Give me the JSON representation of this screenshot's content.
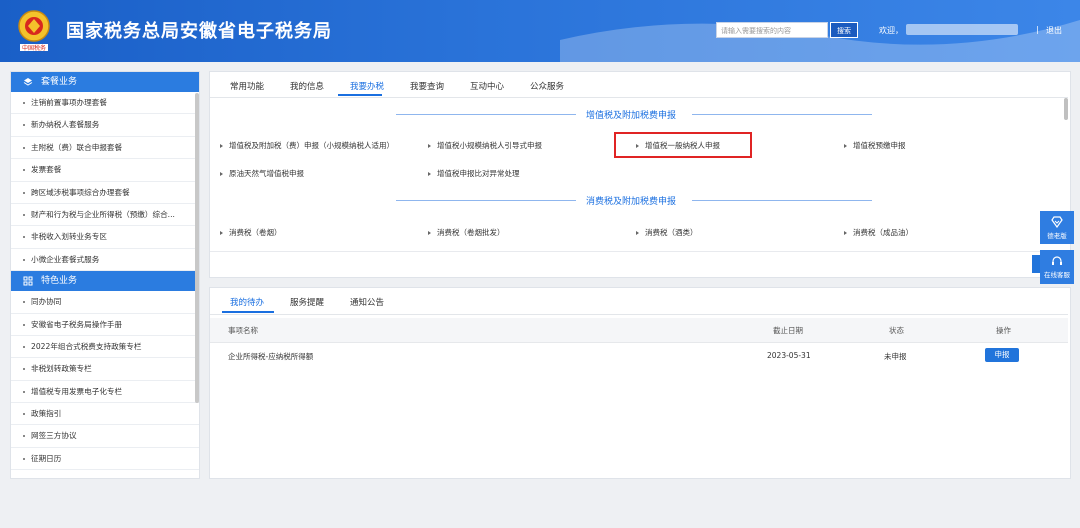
{
  "header": {
    "title": "国家税务总局安徽省电子税务局",
    "search_placeholder": "请输入需要搜索的内容",
    "search_button": "搜索",
    "welcome": "欢迎，",
    "separator": "|",
    "logout": "退出"
  },
  "sidebar": {
    "section1": "套餐业务",
    "items1": [
      "注销前置事项办理套餐",
      "新办纳税人套餐服务",
      "主附税（费）联合申报套餐",
      "发票套餐",
      "跨区域涉税事项综合办理套餐",
      "财产和行为税与企业所得税（预缴）综合...",
      "非税收入划转业务专区",
      "小微企业套餐式服务"
    ],
    "section2": "特色业务",
    "items2": [
      "同办协同",
      "安徽省电子税务局操作手册",
      "2022年组合式税费支持政策专栏",
      "非税划转政策专栏",
      "增值税专用发票电子化专栏",
      "政策指引",
      "网签三方协议",
      "征期日历"
    ]
  },
  "main_tabs": [
    "常用功能",
    "我的信息",
    "我要办税",
    "我要查询",
    "互动中心",
    "公众服务"
  ],
  "section_vat": {
    "title": "增值税及附加税费申报",
    "links": [
      "增值税及附加税（费）申报（小规模纳税人适用）",
      "增值税小规模纳税人引导式申报",
      "增值税一般纳税人申报",
      "增值税预缴申报",
      "原油天然气增值税申报",
      "增值税申报比对异常处理"
    ]
  },
  "section_consumption": {
    "title": "消费税及附加税费申报",
    "links": [
      "消费税（卷烟）",
      "消费税（卷烟批发）",
      "消费税（酒类）",
      "消费税（成品油）"
    ]
  },
  "bottom_tabs": [
    "我的待办",
    "服务提醒",
    "通知公告"
  ],
  "table": {
    "headers": [
      "事项名称",
      "截止日期",
      "状态",
      "操作"
    ],
    "rows": [
      {
        "name": "企业所得税-应纳税所得额",
        "deadline": "2023-05-31",
        "status": "未申报",
        "action": "申报"
      }
    ]
  },
  "float_buttons": [
    "德老版",
    "在线客服"
  ],
  "emblem_text": "中国税务",
  "colors": {
    "header": "#2a73d9",
    "accent": "#1a6fe0",
    "highlight": "#e02424"
  }
}
